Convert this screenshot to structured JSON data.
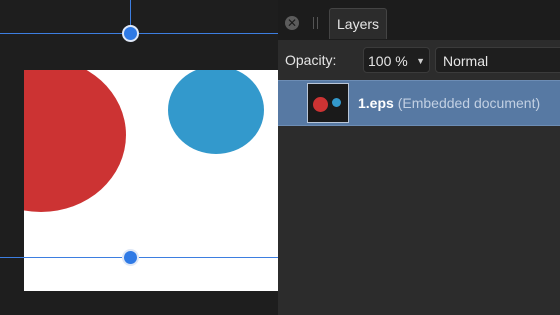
{
  "canvas": {
    "colors": {
      "red_circle": "#cc3333",
      "blue_circle": "#3399cc",
      "guide": "#3d7ee0",
      "artboard": "#ffffff"
    }
  },
  "panel": {
    "close_icon_glyph": "✕",
    "tab_label": "Layers",
    "opacity_label": "Opacity:",
    "opacity_value": "100 %",
    "dropdown_arrow_glyph": "▼",
    "blend_mode": "Normal",
    "layers": [
      {
        "name": "1.eps",
        "description": "(Embedded document)",
        "selected": true
      }
    ],
    "colors": {
      "selection": "#5779a3",
      "background": "#2c2c2c"
    }
  }
}
